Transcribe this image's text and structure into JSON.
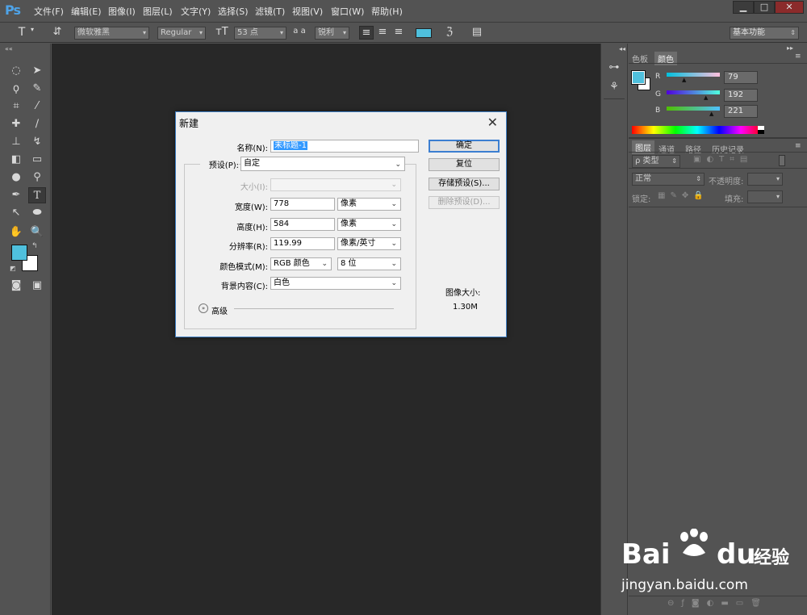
{
  "app": {
    "logo": "Ps"
  },
  "menu": [
    "文件(F)",
    "编辑(E)",
    "图像(I)",
    "图层(L)",
    "文字(Y)",
    "选择(S)",
    "滤镜(T)",
    "视图(V)",
    "窗口(W)",
    "帮助(H)"
  ],
  "window_buttons": {
    "minimize": "▁",
    "maximize": "□",
    "close": "✕"
  },
  "options": {
    "tool_icon": "T",
    "font_family": "微软雅黑",
    "font_style": "Regular",
    "font_size": "53 点",
    "aa_label": "a a",
    "antialias": "锐利",
    "workspace": "基本功能",
    "text_color": "#4fc0dd"
  },
  "dialog": {
    "title": "新建",
    "close": "✕",
    "name_label": "名称(N):",
    "name_value": "未标题-1",
    "preset_label": "预设(P):",
    "preset_value": "自定",
    "size_label": "大小(I):",
    "width_label": "宽度(W):",
    "width_value": "778",
    "width_unit": "像素",
    "height_label": "高度(H):",
    "height_value": "584",
    "height_unit": "像素",
    "resolution_label": "分辨率(R):",
    "resolution_value": "119.99",
    "resolution_unit": "像素/英寸",
    "colormode_label": "颜色模式(M):",
    "colormode_value": "RGB 颜色",
    "bitdepth_value": "8 位",
    "background_label": "背景内容(C):",
    "background_value": "白色",
    "advanced_label": "高级",
    "ok": "确定",
    "reset": "复位",
    "save_preset": "存储预设(S)...",
    "delete_preset": "删除预设(D)...",
    "image_size_label": "图像大小:",
    "image_size_value": "1.30M"
  },
  "color_panel": {
    "tab_swatches": "色板",
    "tab_color": "颜色",
    "r_label": "R",
    "r_value": "79",
    "g_label": "G",
    "g_value": "192",
    "b_label": "B",
    "b_value": "221",
    "foreground": "#4fc0dd",
    "background": "#ffffff"
  },
  "layers_panel": {
    "tabs": [
      "图层",
      "通道",
      "路径",
      "历史记录"
    ],
    "filter_kind": "ρ 类型",
    "blend_mode": "正常",
    "opacity_label": "不透明度:",
    "lock_label": "锁定:",
    "fill_label": "填充:"
  },
  "watermark": {
    "brand_a": "Bai",
    "brand_b": "du",
    "brand_cn": "经验",
    "url": "jingyan.baidu.com"
  }
}
